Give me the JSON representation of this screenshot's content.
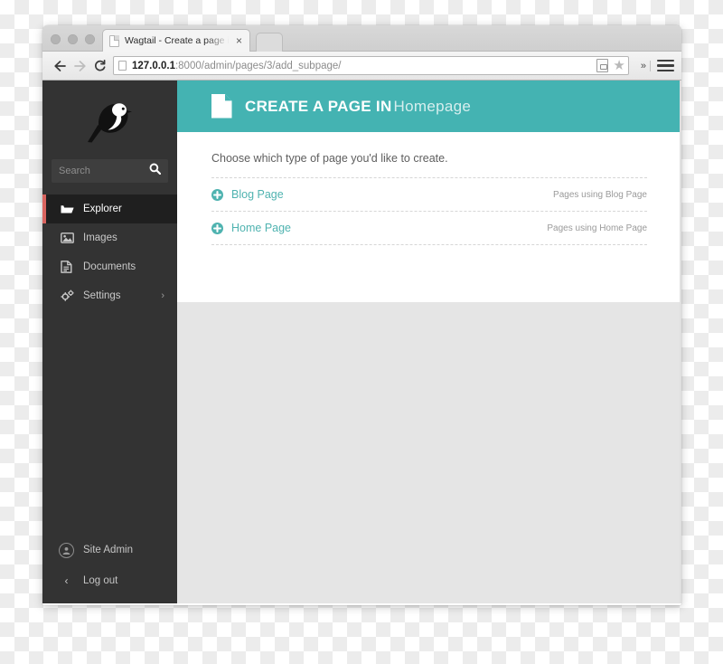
{
  "browser": {
    "tab": {
      "title": "Wagtail - Create a page in",
      "close_label": "×"
    },
    "toolbar": {
      "back_icon": "back-arrow-icon",
      "forward_icon": "forward-arrow-icon",
      "reload_icon": "reload-icon",
      "url_host": "127.0.0.1",
      "url_path": ":8000/admin/pages/3/add_subpage/",
      "url_full": "127.0.0.1:8000/admin/pages/3/add_subpage/",
      "overflow_label": "»",
      "star_glyph": "★"
    }
  },
  "sidebar": {
    "logo_name": "wagtail-bird-logo",
    "search": {
      "placeholder": "Search"
    },
    "items": [
      {
        "label": "Explorer",
        "icon": "folder-open-icon",
        "active": true
      },
      {
        "label": "Images",
        "icon": "image-icon",
        "active": false
      },
      {
        "label": "Documents",
        "icon": "document-icon",
        "active": false
      },
      {
        "label": "Settings",
        "icon": "gears-icon",
        "active": false,
        "chevron": "›"
      }
    ],
    "footer": {
      "user_label": "Site Admin",
      "logout_label": "Log out",
      "logout_chevron": "‹"
    }
  },
  "header": {
    "title_strong": "CREATE A PAGE IN",
    "title_sub": "Homepage",
    "icon": "page-document-icon"
  },
  "content": {
    "intro": "Choose which type of page you'd like to create.",
    "page_types": [
      {
        "label": "Blog Page",
        "usage": "Pages using Blog Page"
      },
      {
        "label": "Home Page",
        "usage": "Pages using Home Page"
      }
    ]
  },
  "colors": {
    "teal": "#44b3b2",
    "sidebar": "#333333",
    "sidebar_active": "#1f1f1f",
    "accent_red": "#d9645f",
    "link_teal": "#4fb3b0",
    "page_background": "#e5e5e5"
  }
}
